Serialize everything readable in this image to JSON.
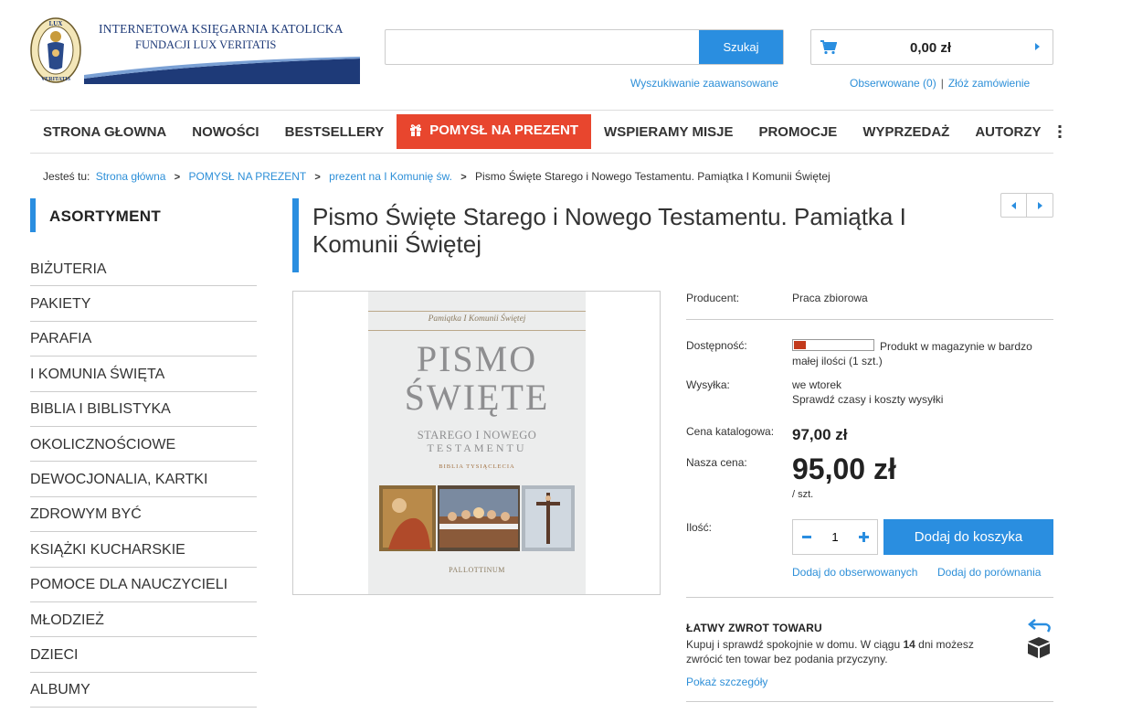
{
  "header": {
    "logo_line1": "INTERNETOWA KSIĘGARNIA KATOLICKA",
    "logo_line2": "FUNDACJI LUX VERITATIS",
    "logo_seal_text": "LUX VERITATIS",
    "search_placeholder": "",
    "search_button": "Szukaj",
    "advanced_search": "Wyszukiwanie zaawansowane",
    "cart_total": "0,00 zł",
    "watched": "Obserwowane (0)",
    "separator": "|",
    "place_order": "Złóż zamówienie"
  },
  "nav": {
    "items": [
      "STRONA GŁOWNA",
      "NOWOŚCI",
      "BESTSELLERY",
      "POMYSŁ NA PREZENT",
      "WSPIERAMY MISJE",
      "PROMOCJE",
      "WYPRZEDAŻ",
      "AUTORZY"
    ],
    "highlight_color": "#e8462e"
  },
  "breadcrumb": {
    "prefix": "Jesteś tu:",
    "items": [
      "Strona główna",
      "POMYSŁ NA PREZENT",
      "prezent na I Komunię św.",
      "Pismo Święte Starego i Nowego Testamentu. Pamiątka I Komunii Świętej"
    ]
  },
  "sidebar": {
    "heading": "ASORTYMENT",
    "items": [
      "BIŻUTERIA",
      "PAKIETY",
      "PARAFIA",
      "I KOMUNIA ŚWIĘTA",
      "BIBLIA I BIBLISTYKA",
      "OKOLICZNOŚCIOWE",
      "DEWOCJONALIA, KARTKI",
      "ZDROWYM BYĆ",
      "KSIĄŻKI KUCHARSKIE",
      "POMOCE DLA NAUCZYCIELI",
      "MŁODZIEŻ",
      "DZIECI",
      "ALBUMY"
    ]
  },
  "product": {
    "title": "Pismo Święte Starego i Nowego Testamentu. Pamiątka I Komunii Świętej",
    "cover": {
      "subtitle": "Pamiątka I Komunii Świętej",
      "line1": "PISMO",
      "line2": "ŚWIĘTE",
      "line3": "STAREGO I NOWEGO",
      "line4": "TESTAMENTU",
      "line5": "BIBLIA TYSIĄCLECIA",
      "publisher": "PALLOTTINUM"
    },
    "producer_label": "Producent:",
    "producer_value": "Praca zbiorowa",
    "availability_label": "Dostępność:",
    "availability_text": "Produkt w magazynie w bardzo małej ilości (1 szt.)",
    "availability_level": 0.15,
    "shipping_label": "Wysyłka:",
    "shipping_value": "we wtorek",
    "shipping_link": "Sprawdź czasy i koszty wysyłki",
    "catalog_price_label": "Cena katalogowa:",
    "catalog_price": "97,00 zł",
    "our_price_label": "Nasza cena:",
    "our_price": "95,00 zł",
    "per_unit": "/ szt.",
    "qty_label": "Ilość:",
    "qty_value": "1",
    "add_to_cart": "Dodaj do koszyka",
    "add_to_watch": "Dodaj do obserwowanych",
    "add_to_compare": "Dodaj do porównania"
  },
  "returns": {
    "title": "ŁATWY ZWROT TOWARU",
    "text_before": "Kupuj i sprawdź spokojnie w domu. W ciągu ",
    "days": "14",
    "text_after": " dni możesz zwrócić ten towar bez podania przyczyny.",
    "link": "Pokaż szczegóły"
  },
  "colors": {
    "accent": "#2a8ee0",
    "gift": "#e8462e",
    "logo_blue": "#1e3a78"
  }
}
